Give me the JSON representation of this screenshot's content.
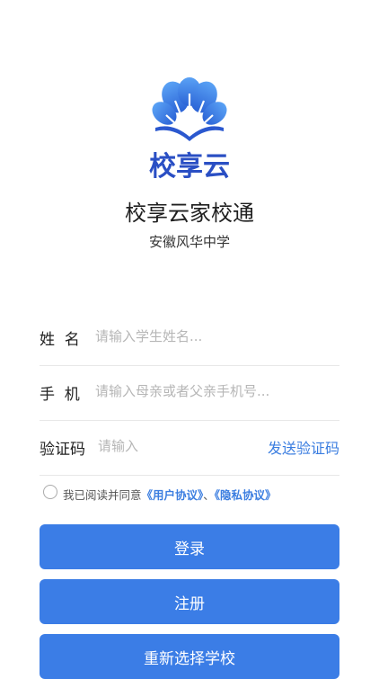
{
  "brand": {
    "logo_text": "校享云",
    "app_title": "校享云家校通",
    "school_name": "安徽风华中学",
    "accent_color": "#3b7de6",
    "logo_icon": "ginkgo-book-icon"
  },
  "form": {
    "name": {
      "label": "姓  名",
      "placeholder": "请输入学生姓名..."
    },
    "phone": {
      "label": "手  机",
      "placeholder": "请输入母亲或者父亲手机号..."
    },
    "code": {
      "label": "验证码",
      "placeholder": "请输入",
      "send_label": "发送验证码"
    }
  },
  "agreement": {
    "prefix": "我已阅读并同意",
    "user_agreement": "《用户协议》",
    "separator": "、",
    "privacy_policy": "《隐私协议》",
    "checked": false
  },
  "buttons": {
    "login": "登录",
    "register": "注册",
    "reselect_school": "重新选择学校"
  }
}
